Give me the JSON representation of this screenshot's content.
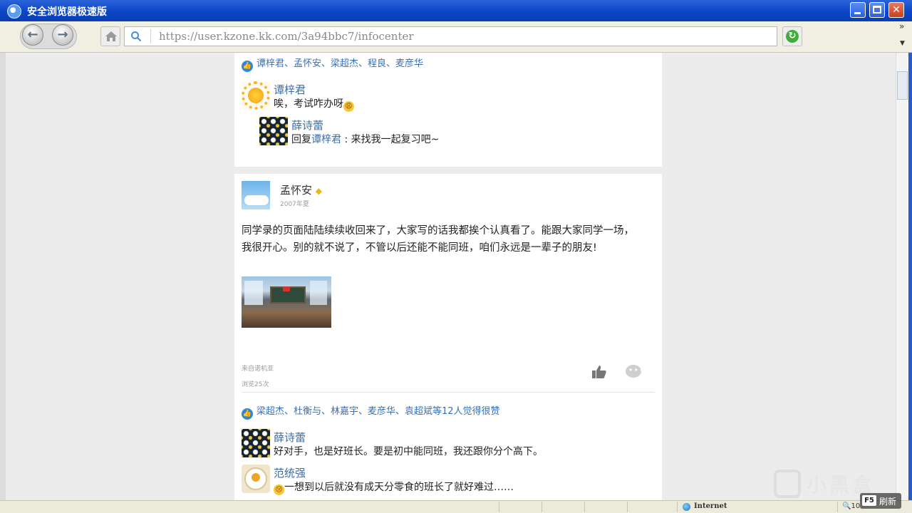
{
  "window": {
    "title": "安全浏览器极速版"
  },
  "toolbar": {
    "url": "https://user.kzone.kk.com/3a94bbc7/infocenter",
    "chevron": "»"
  },
  "post1": {
    "likes_text": "谭梓君、孟怀安、梁超杰、程良、麦彦华",
    "comment": {
      "author": "谭梓君",
      "text": "唉，考试咋办呀"
    },
    "reply": {
      "author": "薛诗蕾",
      "prefix": "回复",
      "target": "谭梓君",
      "text": " : 来找我一起复习吧~"
    }
  },
  "post2": {
    "author": "孟怀安",
    "date": "2007年夏",
    "body_line1": "同学录的页面陆陆续续收回来了，大家写的话我都挨个认真看了。能跟大家同学一场，",
    "body_line2": "我很开心。别的就不说了，不管以后还能不能同班，咱们永远是一辈子的朋友!",
    "source": "来自诺机亚",
    "views": "浏览25次",
    "likes_text": "梁超杰、杜衡与、林嘉宇、麦彦华、袁超斌等12人觉得很赞",
    "comments": [
      {
        "author": "薛诗蕾",
        "text": "好对手，也是好班长。要是初中能同班，我还跟你分个高下。"
      },
      {
        "author": "范统强",
        "text": "一想到以后就没有成天分零食的班长了就好难过……"
      }
    ]
  },
  "statusbar": {
    "zone": "Internet",
    "zoom": "10"
  },
  "overlay": {
    "f5_key": "F5",
    "f5_label": "刷新",
    "watermark": "小黑盒"
  },
  "colors": {
    "titlebar": "#0c46c8",
    "link": "#3c6ea6",
    "like_icon": "#2e87d8"
  }
}
